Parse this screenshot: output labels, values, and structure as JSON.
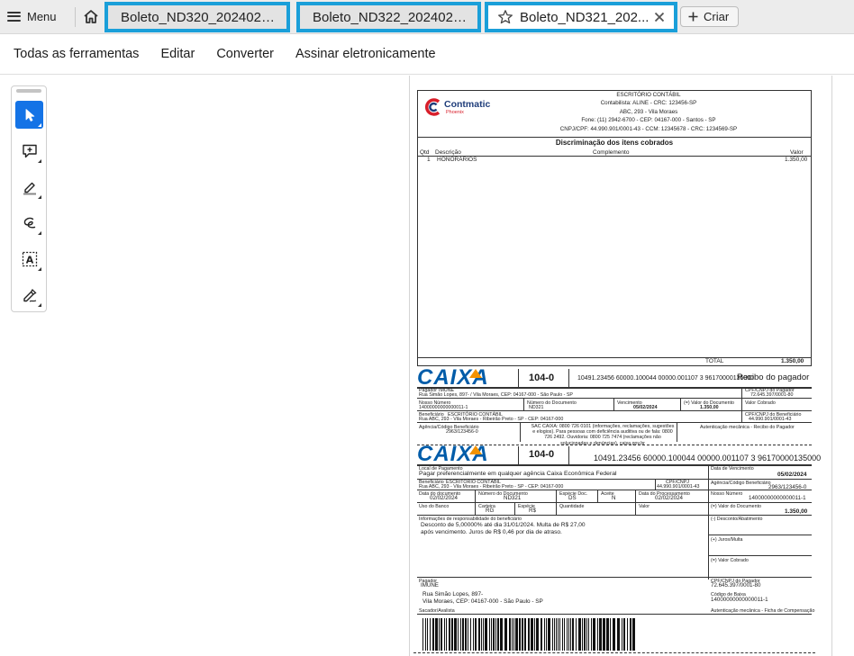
{
  "topbar": {
    "menu_label": "Menu",
    "tabs": [
      {
        "label": "Boleto_ND320_20240202_..."
      },
      {
        "label": "Boleto_ND322_20240202_..."
      },
      {
        "label": "Boleto_ND321_202..."
      }
    ],
    "create_label": "Criar"
  },
  "menubar": {
    "items": [
      "Todas as ferramentas",
      "Editar",
      "Converter",
      "Assinar eletronicamente"
    ]
  },
  "tools": [
    {
      "icon": "select-cursor-icon"
    },
    {
      "icon": "add-comment-icon"
    },
    {
      "icon": "highlight-pen-icon"
    },
    {
      "icon": "draw-freeform-icon"
    },
    {
      "icon": "text-recognition-icon"
    },
    {
      "icon": "sign-pen-icon"
    }
  ],
  "colors": {
    "tab_highlight": "#1a9fd9",
    "active_tool": "#1473e6",
    "caixa_blue": "#005ca9",
    "caixa_orange": "#f39200",
    "logo_red": "#d81e2a"
  },
  "document": {
    "header": {
      "logo_name": "Contmatic",
      "logo_sub": "Phoenix",
      "office_title": "ESCRITÓRIO CONTÁBIL",
      "office_lines": [
        "Contabilista: ALINE - CRC: 123456-SP",
        "ABC, 293 - Vila Moraes",
        "Fone: (11) 2942-6700 - CEP: 04167-000 - Santos - SP",
        "CNPJ/CPF: 44.990.901/0001-43 - CCM: 12345678 - CRC: 1234569-SP"
      ]
    },
    "items": {
      "title": "Discriminação dos itens cobrados",
      "col_qtd": "Qtd",
      "col_desc": "Descrição",
      "col_compl": "Complemento",
      "col_valor": "Valor",
      "row_qtd": "1",
      "row_desc": "HONORÁRIOS",
      "row_valor": "1.350,00",
      "total_label": "TOTAL",
      "total_value": "1.350,00"
    },
    "receipt": {
      "bank_logo": "CAIXA",
      "bank_code": "104-0",
      "digitable_line": "10491.23456 60000.100044 00000.001107 3 96170000135000",
      "receipt_label": "Recibo do pagador",
      "payer_label": "Pagador",
      "payer_name": "IMUNE",
      "payer_address": "Rua Simão Lopes, 897- / Vila Moraes, CEP: 04167-000 - São Paulo - SP",
      "payer_cnpj_label": "CPF/CNPJ do Pagador",
      "payer_cnpj": "72.645.397/0001-80",
      "our_number_label": "Nosso Número",
      "our_number": "14000000000000011-1",
      "doc_number_label": "Número do Documento",
      "doc_number": "ND321",
      "due_label": "Vencimento",
      "due": "05/02/2024",
      "doc_value_label": "(=) Valor do Documento",
      "doc_value": "1.350,00",
      "paid_label": "Valor Cobrado",
      "beneficiary_label": "Beneficiário",
      "beneficiary": "ESCRITÓRIO CONTÁBIL",
      "beneficiary_address": "Rua ABC, 293 - Vila Moraes - Ribeirão Preto - SP - CEP: 04167-000",
      "beneficiary_cnpj_label": "CPF/CNPJ do Beneficiário",
      "beneficiary_cnpj": "44.990.901/0001-43",
      "agency_label": "Agência/Código Beneficiário",
      "agency": "2963/123456-0",
      "sac": "SAC CAIXA: 0800 726 0101 (informações, reclamações, sugestões e elogios). Para pessoas com deficiência auditiva ou de fala: 0800 726 2492. Ouvidoria: 0800 725 7474 (reclamações não solucionadas e denúncias). caixa.gov.br",
      "auth_label": "Autenticação mecânica - Recibo do Pagador"
    },
    "slip": {
      "bank_logo": "CAIXA",
      "bank_code": "104-0",
      "digitable_line": "10491.23456 60000.100044 00000.001107 3 96170000135000",
      "place_label": "Local de Pagamento",
      "place": "Pagar preferencialmente em qualquer agência Caixa Econômica Federal",
      "due_label": "Data de Vencimento",
      "due": "05/02/2024",
      "beneficiary_label": "Beneficiário",
      "beneficiary": "ESCRITÓRIO CONTÁBIL",
      "beneficiary_address": "Rua ABC, 293 - Vila Moraes - Ribeirão Preto - SP - CEP: 04167-000",
      "beneficiary_cnpj_label": "CPF/CNPJ",
      "beneficiary_cnpj": "44.990.901/0001-43",
      "agency_label": "Agência/Código Beneficiário",
      "agency": "2963/123456-0",
      "doc_date_label": "Data do documento",
      "doc_date": "02/02/2024",
      "doc_number_label": "Número do Documento",
      "doc_number": "ND321",
      "species_doc_label": "Espécie Doc.",
      "species_doc": "DS",
      "accept_label": "Aceite",
      "accept": "N",
      "process_date_label": "Data do Processamento",
      "process_date": "02/02/2024",
      "our_number_label": "Nosso Número",
      "our_number": "14000000000000011-1",
      "bank_use_label": "Uso do Banco",
      "wallet_label": "Carteira",
      "wallet": "RG",
      "species_label": "Espécie",
      "species": "R$",
      "quantity_label": "Quantidade",
      "value_label": "Valor",
      "doc_value_label": "(=) Valor do Documento",
      "doc_value": "1.350,00",
      "discount_label": "(-) Desconto/Abatimento",
      "interest_label": "(+) Juros/Multa",
      "charged_label": "(=) Valor Cobrado",
      "info_label": "Informações de responsabilidade do beneficiário",
      "info_line1": "Desconto de 5,00000% até dia 31/01/2024. Multa de R$ 27,00",
      "info_line2": "após vencimento. Juros de R$ 0,46 por dia de atraso.",
      "payer_label": "Pagador",
      "payer_name": "IMUNE",
      "payer_addr1": "Rua Simão Lopes, 897-",
      "payer_addr2": "Vila Moraes, CEP: 04167-000 - São Paulo - SP",
      "payer_cnpj_label": "CPF/CNPJ do Pagador",
      "payer_cnpj": "72.645.397/0001-80",
      "bank_code_label": "Código de Baixa",
      "bank_code_value": "14000000000000011-1",
      "guarantor_label": "Sacador/Avalista",
      "auth_label": "Autenticação mecânica - Ficha de Compensação"
    }
  }
}
